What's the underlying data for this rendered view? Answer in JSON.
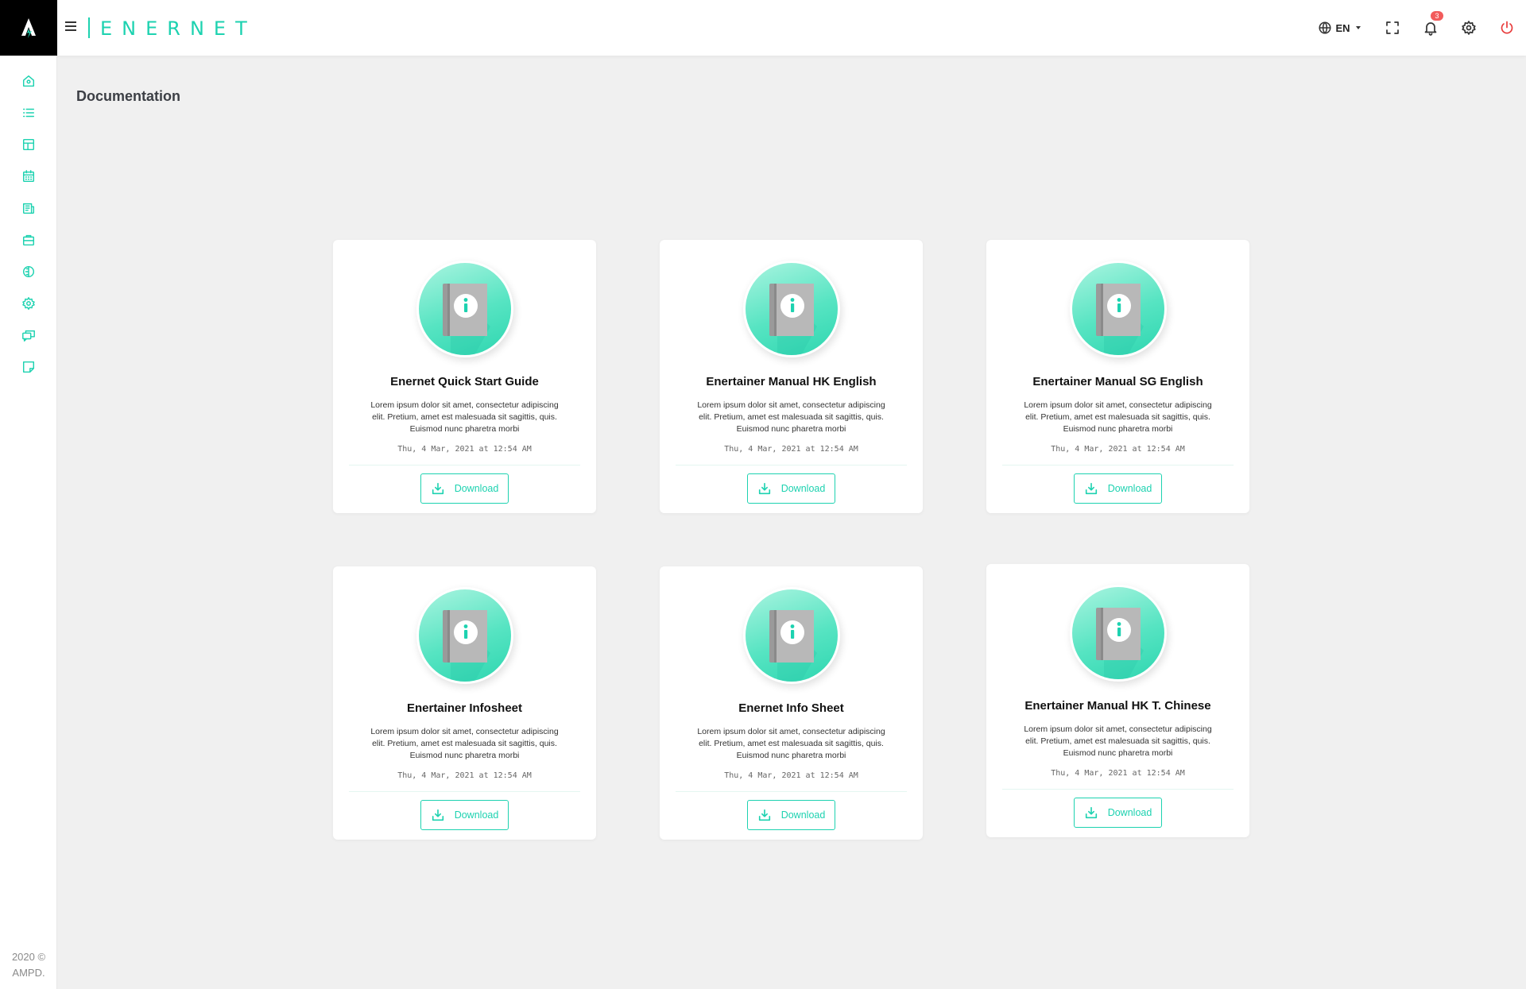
{
  "app": {
    "brand": "ENERNET"
  },
  "sidebar": {
    "items": [
      {
        "icon": "home-icon"
      },
      {
        "icon": "list-icon"
      },
      {
        "icon": "layout-icon"
      },
      {
        "icon": "calendar-icon"
      },
      {
        "icon": "report-icon"
      },
      {
        "icon": "briefcase-icon"
      },
      {
        "icon": "globe-half-icon"
      },
      {
        "icon": "gear-icon"
      },
      {
        "icon": "chat-icon"
      },
      {
        "icon": "note-icon"
      }
    ],
    "footer_line1": "2020 ©",
    "footer_line2": "AMPD."
  },
  "header": {
    "language": "EN",
    "notification_count": "3"
  },
  "page": {
    "title": "Documentation"
  },
  "cards": [
    {
      "title": "Enernet Quick Start Guide",
      "description": "Lorem ipsum dolor sit amet, consectetur adipiscing elit. Pretium, amet est malesuada sit sagittis, quis. Euismod nunc pharetra morbi",
      "date": "Thu, 4 Mar, 2021 at 12:54 AM",
      "button": "Download"
    },
    {
      "title": "Enertainer Manual HK English",
      "description": "Lorem ipsum dolor sit amet, consectetur adipiscing elit. Pretium, amet est malesuada sit sagittis, quis. Euismod nunc pharetra morbi",
      "date": "Thu, 4 Mar, 2021 at 12:54 AM",
      "button": "Download"
    },
    {
      "title": "Enertainer Manual SG English",
      "description": "Lorem ipsum dolor sit amet, consectetur adipiscing elit. Pretium, amet est malesuada sit sagittis, quis. Euismod nunc pharetra morbi",
      "date": "Thu, 4 Mar, 2021 at 12:54 AM",
      "button": "Download"
    },
    {
      "title": "Enertainer Infosheet",
      "description": "Lorem ipsum dolor sit amet, consectetur adipiscing elit. Pretium, amet est malesuada sit sagittis, quis. Euismod nunc pharetra morbi",
      "date": "Thu, 4 Mar, 2021 at 12:54 AM",
      "button": "Download"
    },
    {
      "title": "Enernet Info Sheet",
      "description": "Lorem ipsum dolor sit amet, consectetur adipiscing elit. Pretium, amet est malesuada sit sagittis, quis. Euismod nunc pharetra morbi",
      "date": "Thu, 4 Mar, 2021 at 12:54 AM",
      "button": "Download"
    },
    {
      "title": "Enertainer Manual HK T. Chinese",
      "description": "Lorem ipsum dolor sit amet, consectetur adipiscing elit. Pretium, amet est malesuada sit sagittis, quis. Euismod nunc pharetra morbi",
      "date": "Thu, 4 Mar, 2021 at 12:54 AM",
      "button": "Download"
    }
  ],
  "colors": {
    "accent": "#1dd2b0",
    "power": "#e83b3b",
    "badge": "#f25b5b"
  }
}
